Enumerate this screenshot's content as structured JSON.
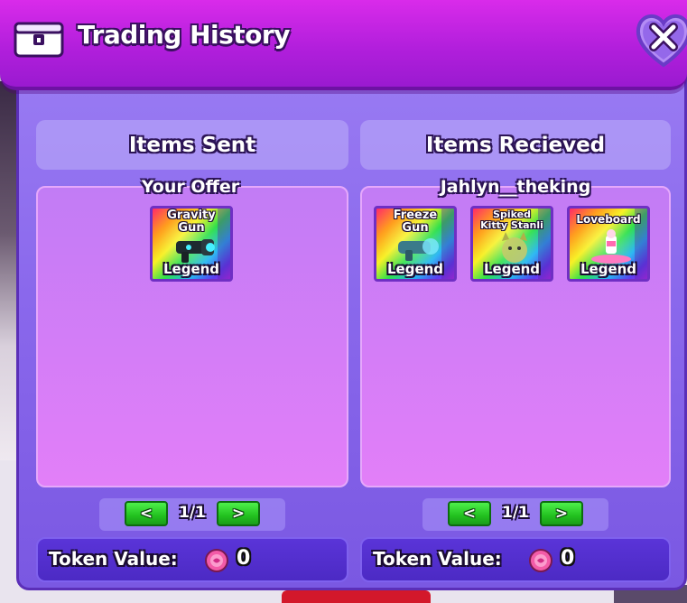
{
  "window": {
    "title": "Trading History",
    "icons": {
      "header": "chest-icon",
      "close": "heart-close-icon"
    }
  },
  "panels": [
    {
      "header": "Items Sent",
      "owner_label": "Your Offer",
      "items": [
        {
          "name": "Gravity Gun",
          "name_lines": [
            "Gravity",
            "Gun"
          ],
          "rarity": "Legend",
          "icon": "gravity-gun-icon"
        }
      ],
      "pager": {
        "prev": "<",
        "page": "1/1",
        "next": ">"
      },
      "token": {
        "label": "Token Value:",
        "value": "0",
        "icon": "token-coin-icon"
      }
    },
    {
      "header": "Items Recieved",
      "owner_label": "Jahlyn__theking",
      "items": [
        {
          "name": "Freeze Gun",
          "name_lines": [
            "Freeze",
            "Gun"
          ],
          "rarity": "Legend",
          "icon": "freeze-gun-icon"
        },
        {
          "name": "Spiked Kitty Stanli",
          "name_lines": [
            "Spiked",
            "Kitty Stanli"
          ],
          "rarity": "Legend",
          "icon": "spiked-kitty-icon"
        },
        {
          "name": "Loveboard",
          "name_lines": [
            "Loveboard"
          ],
          "rarity": "Legend",
          "icon": "loveboard-icon"
        }
      ],
      "pager": {
        "prev": "<",
        "page": "1/1",
        "next": ">"
      },
      "token": {
        "label": "Token Value:",
        "value": "0",
        "icon": "token-coin-icon"
      }
    }
  ],
  "colors": {
    "header": "#c724e6",
    "window": "#8a68ec",
    "item_box": "#d47df7",
    "pager_button": "#22c11f",
    "token_bar": "#5230cf"
  }
}
